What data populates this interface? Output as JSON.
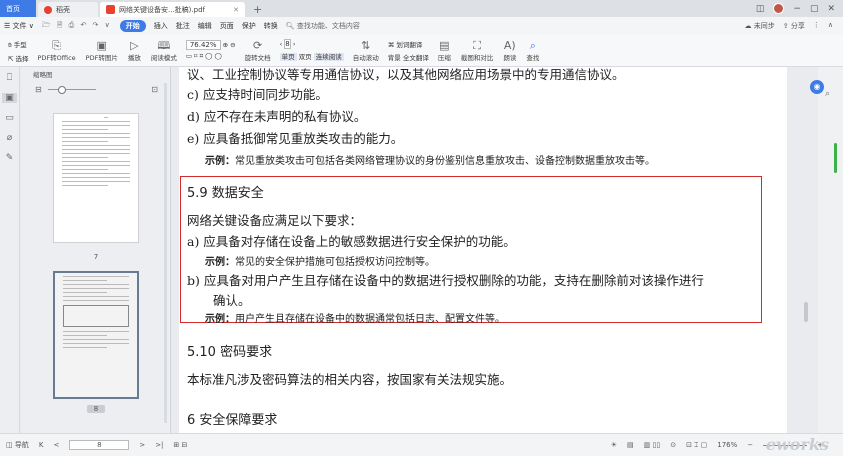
{
  "tabs": {
    "home": "首页",
    "straw": "稻壳",
    "pdf": "网络关键设备安...批稿).pdf",
    "plus": "+"
  },
  "window": {
    "min": "−",
    "max": "▢",
    "close": "✕"
  },
  "menu": {
    "file": "☰ 文件 ∨",
    "quick": "🗁 🗎 ⎙ ↶ ↷ ∨",
    "start": "开始",
    "items": [
      "插入",
      "批注",
      "编辑",
      "页面",
      "保护",
      "转换"
    ],
    "search": "查找功能、文档内容",
    "sync": "未同步",
    "share": "分享"
  },
  "toolbar": {
    "hand": "手型",
    "select": "选择",
    "pdf_to_office": "PDF转Office",
    "pdf_to_image": "PDF转图片",
    "play": "播放",
    "read_mode": "阅读模式",
    "zoom": "76.42%",
    "rotate": "旋转文档",
    "page": "8",
    "single": "单页",
    "double": "双页",
    "continuous": "连续阅读",
    "auto_scroll": "自动滚动",
    "background": "背景",
    "translate": "划词翻译",
    "full_translate": "全文翻译",
    "compress": "压缩",
    "screenshot_compare": "截图和对比",
    "read_aloud": "朗读",
    "find": "查找"
  },
  "thumbs": {
    "title": "缩略图",
    "pages": [
      "7",
      "8"
    ]
  },
  "doc": {
    "l1": "议、工业控制协议等专用通信协议，以及其他网络应用场景中的专用通信协议。",
    "l2": "c)   应支持时间同步功能。",
    "l3": "d)   应不存在未声明的私有协议。",
    "l4": "e)   应具备抵御常见重放类攻击的能力。",
    "ex_label": "示例：",
    "l5": "常见重放类攻击可包括各类网络管理协议的身份鉴别信息重放攻击、设备控制数据重放攻击等。",
    "h59": "5.9   数据安全",
    "p1": "网络关键设备应满足以下要求：",
    "a": "a)   应具备对存储在设备上的敏感数据进行安全保护的功能。",
    "ex_a": "常见的安全保护措施可包括授权访问控制等。",
    "b1": "b)   应具备对用户产生且存储在设备中的数据进行授权删除的功能，支持在删除前对该操作进行",
    "b2": "确认。",
    "ex_b": "用户产生且存储在设备中的数据通常包括日志、配置文件等。",
    "h510": "5.10   密码要求",
    "p2": "本标准凡涉及密码算法的相关内容，按国家有关法规实施。",
    "h6": "6   安全保障要求"
  },
  "status": {
    "nav": "导航",
    "page": "8",
    "zoom": "176%"
  },
  "colors": {
    "accent": "#3e7be6",
    "highlight": "#d22b2b",
    "pdf": "#e8412f"
  }
}
